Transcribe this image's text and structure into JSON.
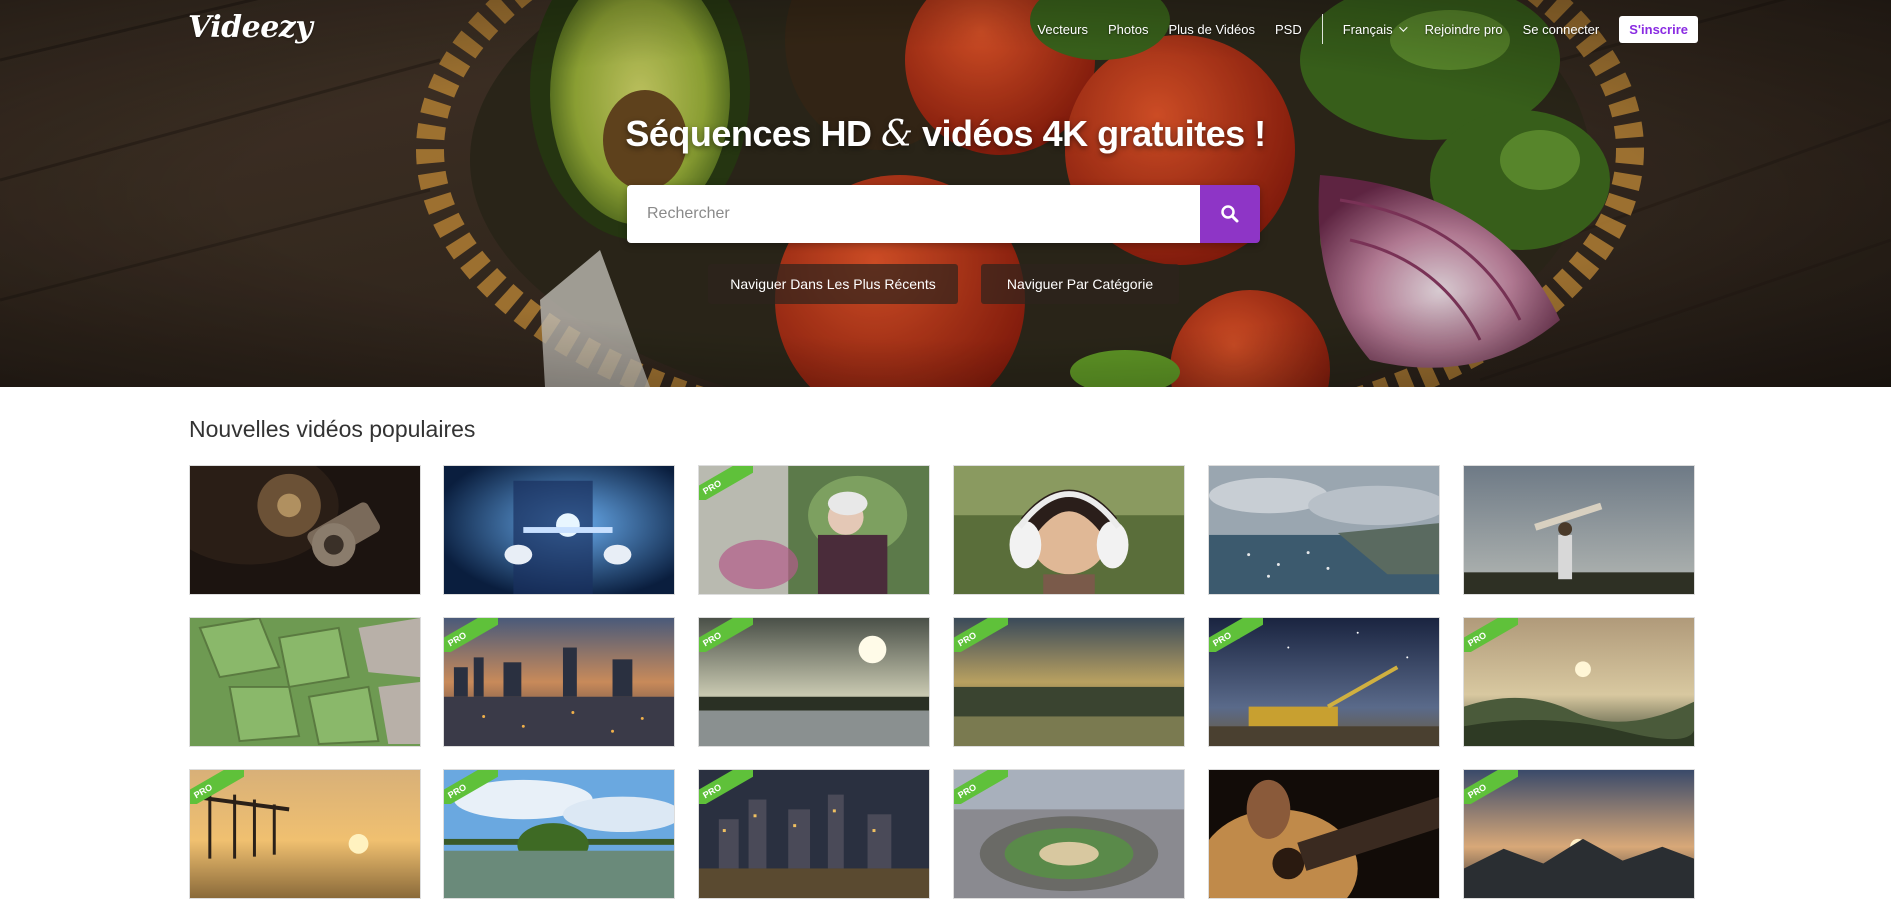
{
  "brand": {
    "logo_text": "Videezy"
  },
  "nav": {
    "links": [
      "Vecteurs",
      "Photos",
      "Plus de Vidéos",
      "PSD"
    ],
    "language": "Français",
    "join_pro": "Rejoindre pro",
    "login": "Se connecter",
    "signup": "S'inscrire"
  },
  "hero": {
    "title_before": "Séquences HD",
    "title_amp": "&",
    "title_after": "vidéos 4K gratuites !",
    "search_placeholder": "Rechercher",
    "browse_recent": "Naviguer Dans Les Plus Récents",
    "browse_category": "Naviguer Par Catégorie"
  },
  "section": {
    "title": "Nouvelles vidéos populaires"
  },
  "pro_label": "PRO",
  "colors": {
    "accent": "#8e35c6",
    "pro_badge": "#5fc13a"
  },
  "videos": [
    {
      "name": "vinyl-record-player",
      "pro": false
    },
    {
      "name": "hologram-tablet",
      "pro": false
    },
    {
      "name": "elderly-woman-garden",
      "pro": true
    },
    {
      "name": "girl-headphones",
      "pro": false
    },
    {
      "name": "harbor-bay",
      "pro": false
    },
    {
      "name": "man-airplane-sunset",
      "pro": false
    },
    {
      "name": "aerial-rice-fields",
      "pro": false
    },
    {
      "name": "city-dusk",
      "pro": true
    },
    {
      "name": "sunset-water-field",
      "pro": true
    },
    {
      "name": "river-sunset",
      "pro": true
    },
    {
      "name": "boat-night-sky",
      "pro": true
    },
    {
      "name": "misty-hills-sunrise",
      "pro": true
    },
    {
      "name": "pier-sunset",
      "pro": true
    },
    {
      "name": "tree-in-lake",
      "pro": true
    },
    {
      "name": "city-skyline-night",
      "pro": true
    },
    {
      "name": "roundabout-city",
      "pro": true
    },
    {
      "name": "guitar-closeup",
      "pro": false
    },
    {
      "name": "mountain-sunrise",
      "pro": true
    }
  ]
}
